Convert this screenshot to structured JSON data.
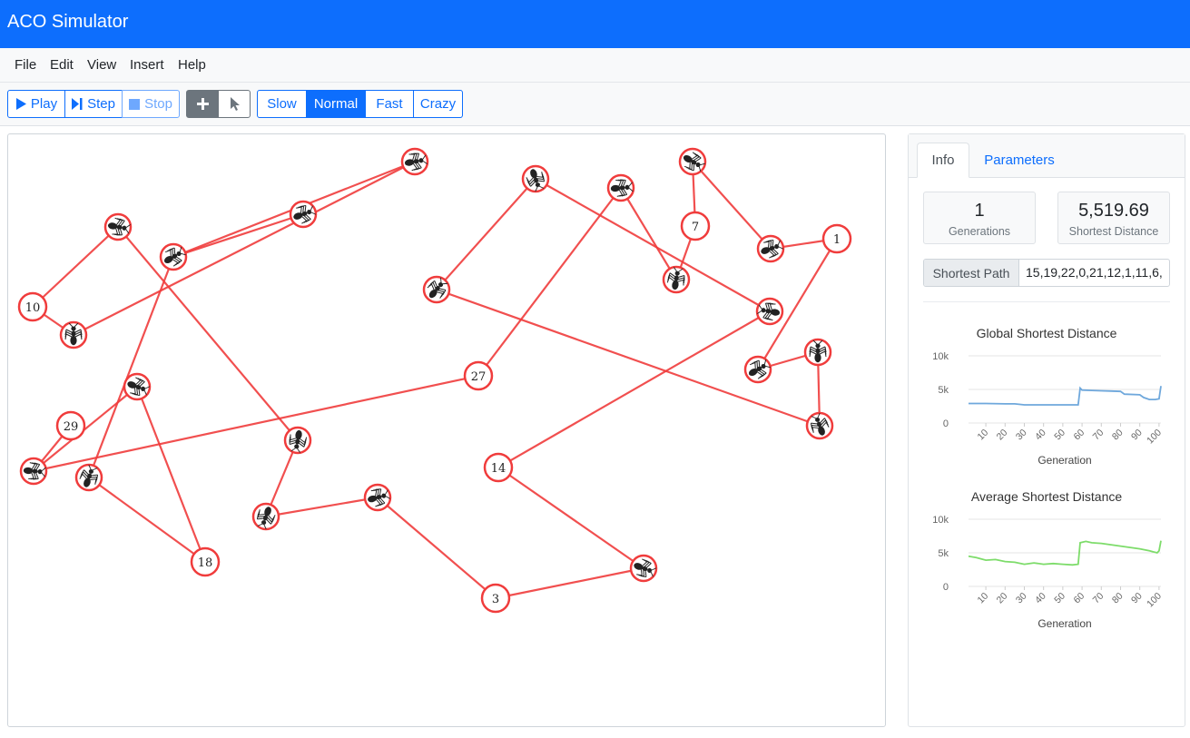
{
  "app": {
    "title": "ACO Simulator"
  },
  "menu": [
    "File",
    "Edit",
    "View",
    "Insert",
    "Help"
  ],
  "toolbar": {
    "play": "Play",
    "step": "Step",
    "stop": "Stop",
    "speeds": [
      "Slow",
      "Normal",
      "Fast",
      "Crazy"
    ],
    "active_speed": "Normal"
  },
  "graph": {
    "edge_color": "#f03c3c",
    "labeled_nodes": [
      "10",
      "29",
      "18",
      "27",
      "7",
      "1",
      "14",
      "3"
    ],
    "ant_count": 22
  },
  "sidebar": {
    "tabs": {
      "info": "Info",
      "parameters": "Parameters"
    },
    "generations": {
      "value": "1",
      "label": "Generations"
    },
    "shortest_distance": {
      "value": "5,519.69",
      "label": "Shortest Distance"
    },
    "shortest_path": {
      "label": "Shortest Path",
      "value": "15,19,22,0,21,12,1,11,6,"
    }
  },
  "chart_data": [
    {
      "type": "line",
      "title": "Global Shortest Distance",
      "xlabel": "Generation",
      "ylabel": "",
      "x_ticks": [
        "10",
        "20",
        "30",
        "40",
        "50",
        "60",
        "70",
        "80",
        "90",
        "100"
      ],
      "y_ticks": [
        "10k",
        "5k",
        "0"
      ],
      "ylim": [
        0,
        10000
      ],
      "xlim": [
        1,
        101
      ],
      "color": "#6fa8dc",
      "series": [
        {
          "x": [
            1,
            10,
            20,
            25,
            30,
            40,
            50,
            58,
            59,
            60,
            65,
            70,
            75,
            80,
            82,
            90,
            92,
            95,
            98,
            100,
            101
          ],
          "values": [
            2900,
            2900,
            2850,
            2850,
            2700,
            2700,
            2700,
            2700,
            5200,
            4900,
            4850,
            4800,
            4750,
            4700,
            4300,
            4200,
            3800,
            3500,
            3500,
            3600,
            5500
          ]
        }
      ]
    },
    {
      "type": "line",
      "title": "Average Shortest Distance",
      "xlabel": "Generation",
      "ylabel": "",
      "x_ticks": [
        "10",
        "20",
        "30",
        "40",
        "50",
        "60",
        "70",
        "80",
        "90",
        "100"
      ],
      "y_ticks": [
        "10k",
        "5k",
        "0"
      ],
      "ylim": [
        0,
        10000
      ],
      "xlim": [
        1,
        101
      ],
      "color": "#7ddc6a",
      "series": [
        {
          "x": [
            1,
            5,
            10,
            15,
            20,
            25,
            30,
            35,
            40,
            45,
            50,
            55,
            58,
            59,
            62,
            65,
            70,
            75,
            80,
            85,
            90,
            95,
            99,
            100,
            101
          ],
          "values": [
            4500,
            4300,
            3900,
            4000,
            3700,
            3600,
            3300,
            3500,
            3300,
            3400,
            3300,
            3200,
            3300,
            6500,
            6700,
            6500,
            6400,
            6200,
            6000,
            5800,
            5600,
            5300,
            5000,
            5300,
            6800
          ]
        }
      ]
    }
  ]
}
